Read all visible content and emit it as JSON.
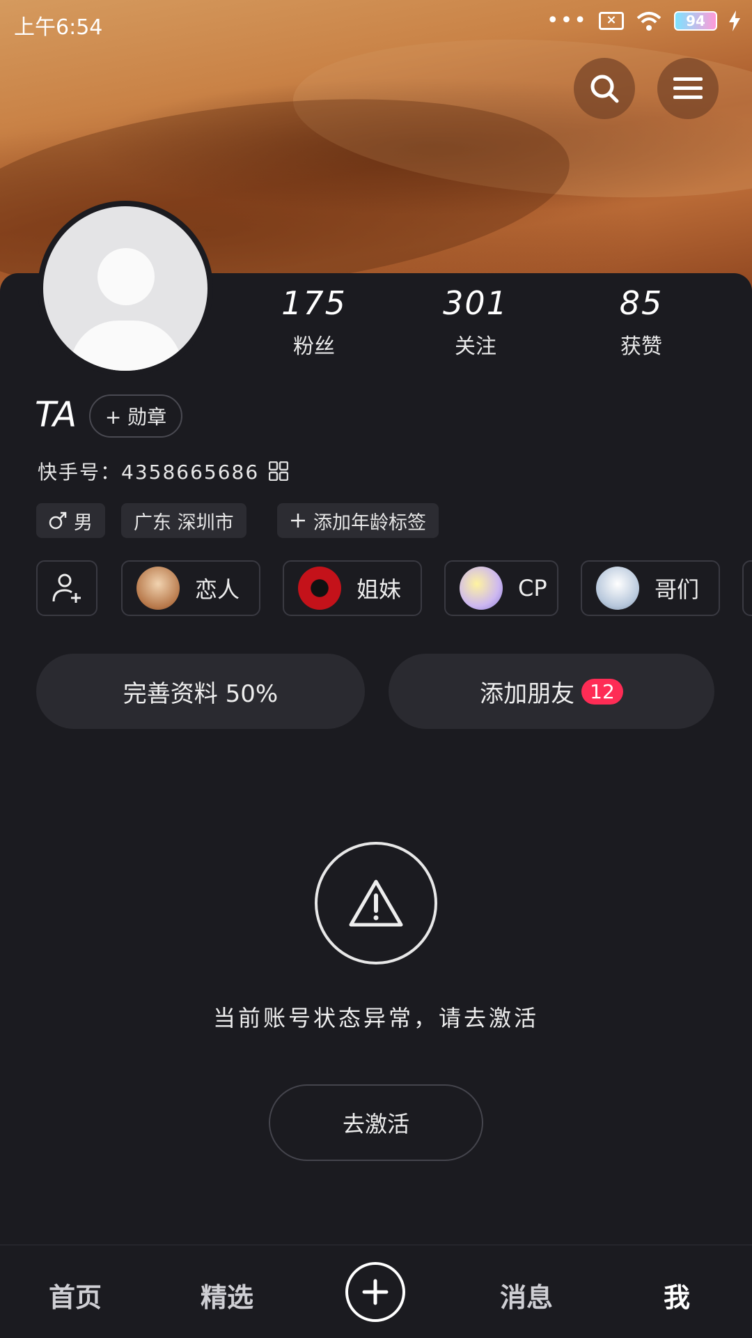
{
  "status_bar": {
    "time": "上午6:54",
    "battery": "94"
  },
  "profile": {
    "stats": [
      {
        "num": "175",
        "label": "粉丝"
      },
      {
        "num": "301",
        "label": "关注"
      },
      {
        "num": "85",
        "label": "获赞"
      }
    ],
    "name": "TA",
    "medal_label": "+ 勋章",
    "kuaishou_id": "快手号：4358665686",
    "tags": [
      {
        "label": "男",
        "icon": "male-icon"
      },
      {
        "label": "广东 深圳市"
      },
      {
        "label": "添加年龄标签",
        "icon": "plus-icon"
      }
    ],
    "relations": [
      {
        "label": "恋人",
        "color": "#d9a070"
      },
      {
        "label": "姐妹",
        "color": "#c4121a"
      },
      {
        "label": "CP",
        "color": "#cdb8f0"
      },
      {
        "label": "哥们",
        "color": "#b8c8dc"
      }
    ],
    "complete_profile_label": "完善资料 50%",
    "add_friend_label": "添加朋友",
    "add_friend_badge": "12"
  },
  "notice": {
    "message": "当前账号状态异常，请去激活",
    "activate_label": "去激活"
  },
  "nav": {
    "items": [
      "首页",
      "精选",
      "消息",
      "我"
    ],
    "active": "我"
  },
  "colors": {
    "accent": "#fe2c55",
    "background": "#1b1b20"
  }
}
